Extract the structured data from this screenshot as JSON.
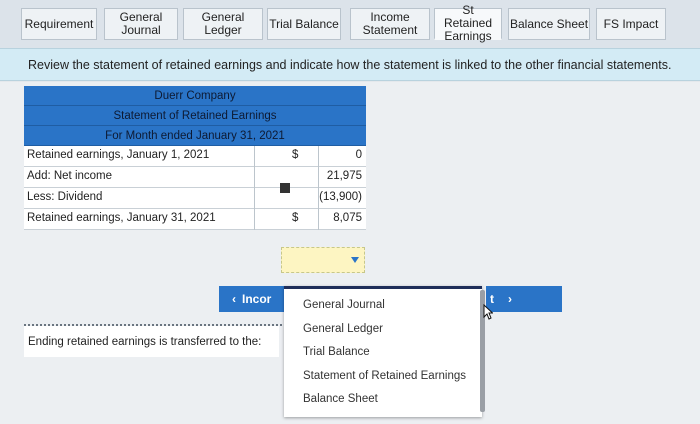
{
  "tabs": [
    {
      "label": "Requirement",
      "active": false
    },
    {
      "label": "General Journal",
      "active": false
    },
    {
      "label": "General Ledger",
      "active": false
    },
    {
      "label": "Trial Balance",
      "active": false
    },
    {
      "label": "Income Statement",
      "active": false
    },
    {
      "label": "St Retained Earnings",
      "active": true
    },
    {
      "label": "Balance Sheet",
      "active": false
    },
    {
      "label": "FS Impact",
      "active": false
    }
  ],
  "instruction": "Review the statement of retained earnings and indicate how the statement is linked to the other financial statements.",
  "statement": {
    "company": "Duerr Company",
    "title": "Statement of Retained Earnings",
    "period": "For Month ended January 31, 2021",
    "rows": [
      {
        "label": "Retained earnings, January 1, 2021",
        "currency": "$",
        "value": "0"
      },
      {
        "label": "Add: Net income",
        "currency": "",
        "value": "21,975"
      },
      {
        "label": "Less: Dividend",
        "currency": "",
        "value": "(13,900)"
      },
      {
        "label": "Retained earnings, January 31, 2021",
        "currency": "$",
        "value": "8,075"
      }
    ]
  },
  "transfer": {
    "label": "Ending retained earnings is transferred to the:",
    "selected": ""
  },
  "nav": {
    "prev_label": "Incor",
    "next_label": "t"
  },
  "dropdown": {
    "options": [
      "General Journal",
      "General Ledger",
      "Trial Balance",
      "Statement of Retained Earnings",
      "Balance Sheet"
    ]
  },
  "colors": {
    "accent": "#2a74c7",
    "header_band": "#2a74c7",
    "instruction_band": "#d3ebf5",
    "select_fill": "#fdf5c2"
  }
}
